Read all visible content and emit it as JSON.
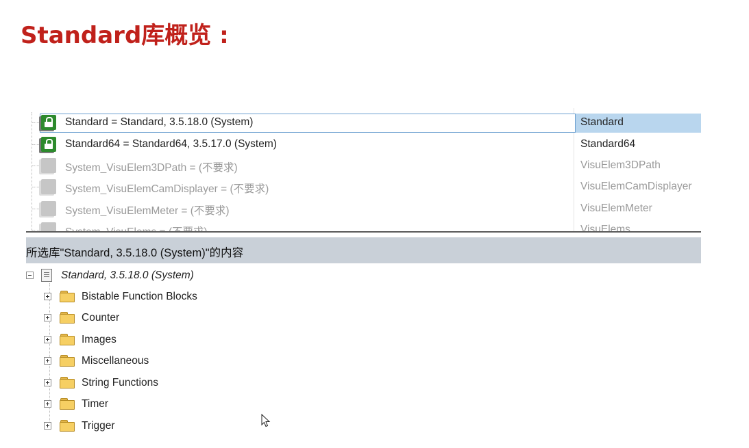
{
  "slide_title": "Standard库概览 :",
  "libraries": [
    {
      "name": "Standard = Standard, 3.5.18.0 (System)",
      "namespace": "Standard",
      "state": "selected",
      "icon": "lock-icon"
    },
    {
      "name": "Standard64 = Standard64, 3.5.17.0 (System)",
      "namespace": "Standard64",
      "state": "normal",
      "icon": "lock-icon"
    },
    {
      "name": "System_VisuElem3DPath = (不要求)",
      "namespace": "VisuElem3DPath",
      "state": "disabled",
      "icon": "library-icon"
    },
    {
      "name": "System_VisuElemCamDisplayer = (不要求)",
      "namespace": "VisuElemCamDisplayer",
      "state": "disabled",
      "icon": "library-icon"
    },
    {
      "name": "System_VisuElemMeter = (不要求)",
      "namespace": "VisuElemMeter",
      "state": "disabled",
      "icon": "library-icon"
    },
    {
      "name": "System_VisuElems = (不要求)",
      "namespace": "VisuElems",
      "state": "disabled",
      "icon": "library-icon"
    }
  ],
  "contents_header": "所选库\"Standard, 3.5.18.0 (System)\"的内容",
  "tree": {
    "root_label": "Standard, 3.5.18.0 (System)",
    "items": [
      {
        "label": "Bistable Function Blocks"
      },
      {
        "label": "Counter"
      },
      {
        "label": "Images"
      },
      {
        "label": "Miscellaneous"
      },
      {
        "label": "String Functions"
      },
      {
        "label": "Timer"
      },
      {
        "label": "Trigger"
      }
    ]
  },
  "colors": {
    "title": "#c0211b",
    "selection": "#b9d6ee",
    "header_bar": "#c9d0d8"
  }
}
